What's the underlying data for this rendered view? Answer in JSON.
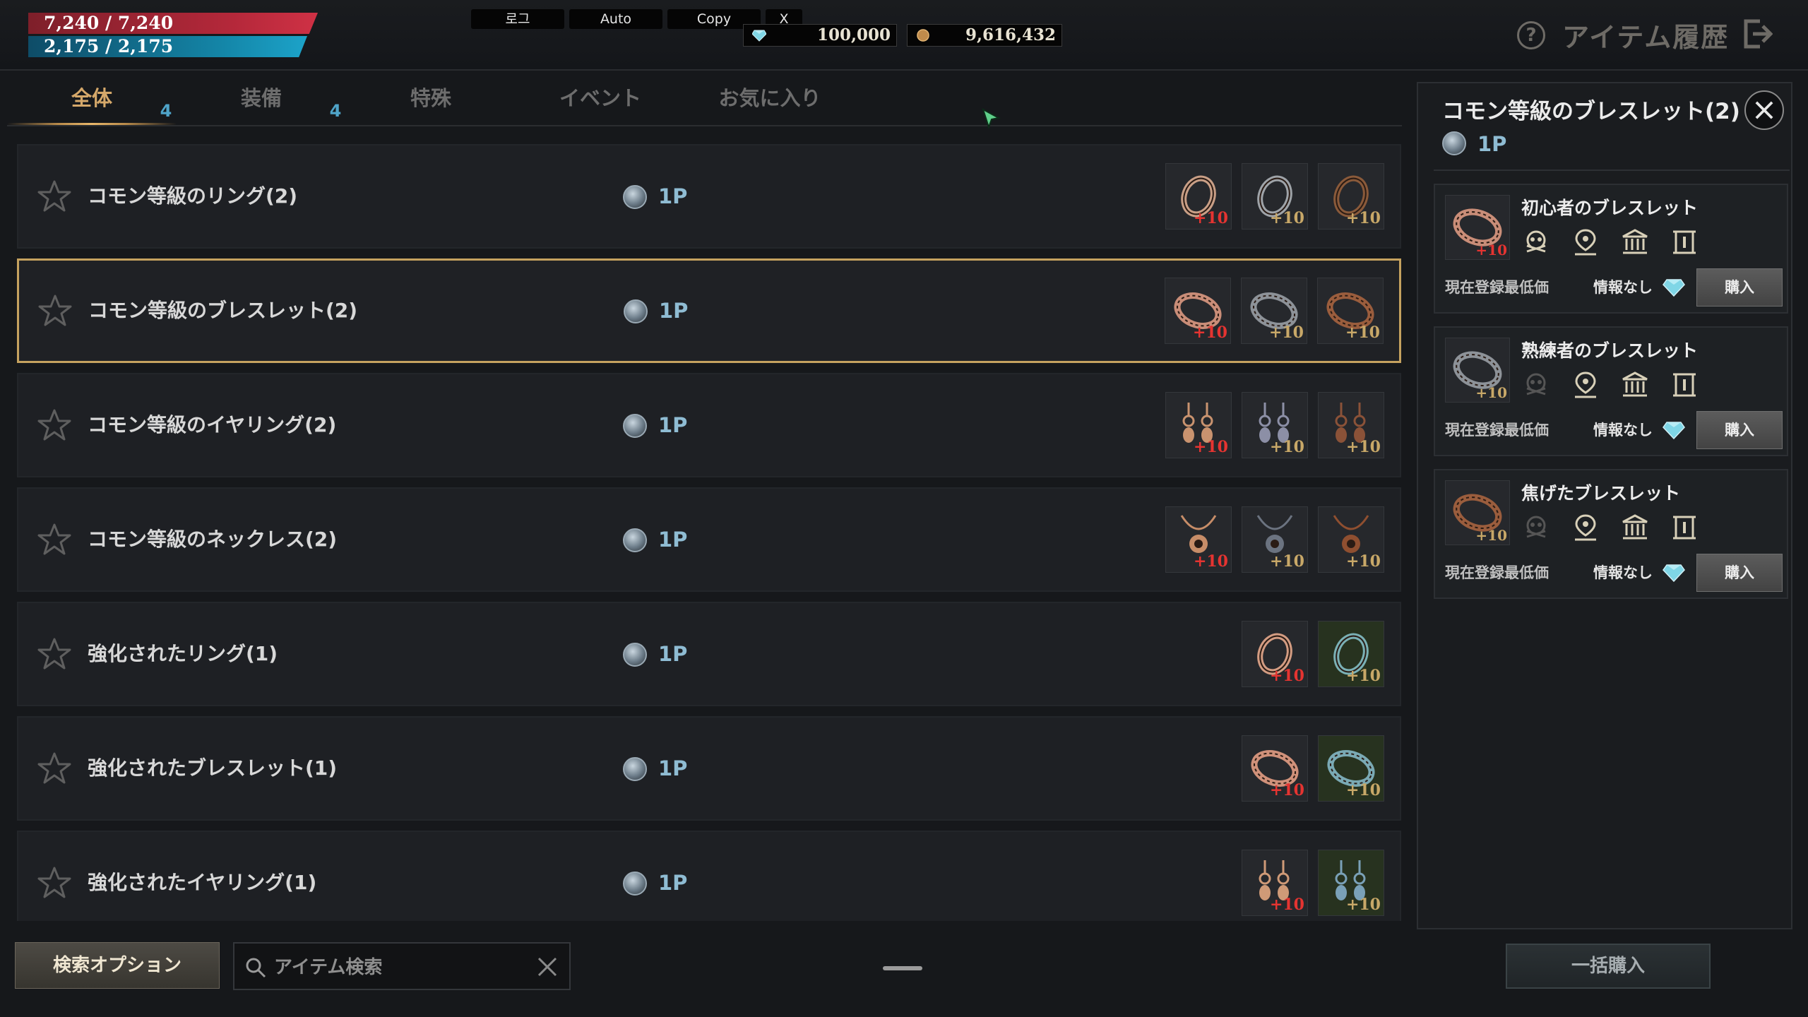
{
  "hud": {
    "hp": "7,240 / 7,240",
    "mp": "2,175 / 2,175"
  },
  "system_buttons": [
    "로그",
    "Auto",
    "Copy",
    "X"
  ],
  "currency": {
    "gems": "100,000",
    "gold": "9,616,432"
  },
  "header": {
    "title": "アイテム履歴"
  },
  "tabs": [
    {
      "label": "全体",
      "count": "4"
    },
    {
      "label": "装備",
      "count": "4"
    },
    {
      "label": "特殊",
      "count": ""
    },
    {
      "label": "イベント",
      "count": ""
    },
    {
      "label": "お気に入り",
      "count": ""
    }
  ],
  "rows": [
    {
      "name": "コモン等級のリング(2)",
      "point": "1P",
      "items": [
        {
          "kind": "ring",
          "color": "#c99f86",
          "plus": "+10",
          "plus_color": "red",
          "bg": "dark"
        },
        {
          "kind": "ring",
          "color": "#9ea3a8",
          "plus": "+10",
          "plus_color": "gold",
          "bg": "dark"
        },
        {
          "kind": "ring",
          "color": "#8a5a3a",
          "plus": "+10",
          "plus_color": "gold",
          "bg": "dark"
        }
      ]
    },
    {
      "name": "コモン等級のブレスレット(2)",
      "point": "1P",
      "items": [
        {
          "kind": "bracelet",
          "color": "#c98d78",
          "plus": "+10",
          "plus_color": "red",
          "bg": "dark"
        },
        {
          "kind": "bracelet",
          "color": "#8d9298",
          "plus": "+10",
          "plus_color": "gold",
          "bg": "dark"
        },
        {
          "kind": "bracelet",
          "color": "#9a5d3d",
          "plus": "+10",
          "plus_color": "gold",
          "bg": "dark"
        }
      ]
    },
    {
      "name": "コモン等級のイヤリング(2)",
      "point": "1P",
      "items": [
        {
          "kind": "earring",
          "color": "#c9936f",
          "plus": "+10",
          "plus_color": "red",
          "bg": "dark"
        },
        {
          "kind": "earring",
          "color": "#8c8fa6",
          "plus": "+10",
          "plus_color": "gold",
          "bg": "dark"
        },
        {
          "kind": "earring",
          "color": "#8b5238",
          "plus": "+10",
          "plus_color": "gold",
          "bg": "dark"
        }
      ]
    },
    {
      "name": "コモン等級のネックレス(2)",
      "point": "1P",
      "items": [
        {
          "kind": "necklace",
          "color": "#c78d68",
          "plus": "+10",
          "plus_color": "red",
          "bg": "dark"
        },
        {
          "kind": "necklace",
          "color": "#6b7380",
          "plus": "+10",
          "plus_color": "gold",
          "bg": "dark"
        },
        {
          "kind": "necklace",
          "color": "#8f4f30",
          "plus": "+10",
          "plus_color": "gold",
          "bg": "dark"
        }
      ]
    },
    {
      "name": "強化されたリング(1)",
      "point": "1P",
      "items": [
        {
          "kind": "ring",
          "color": "#d39c82",
          "plus": "+10",
          "plus_color": "red",
          "bg": "dark"
        },
        {
          "kind": "ring",
          "color": "#7ab0b5",
          "plus": "+10",
          "plus_color": "gold",
          "bg": "green"
        }
      ]
    },
    {
      "name": "強化されたブレスレット(1)",
      "point": "1P",
      "items": [
        {
          "kind": "bracelet",
          "color": "#d0917a",
          "plus": "+10",
          "plus_color": "red",
          "bg": "dark"
        },
        {
          "kind": "bracelet",
          "color": "#7aa9b4",
          "plus": "+10",
          "plus_color": "gold",
          "bg": "green"
        }
      ]
    },
    {
      "name": "強化されたイヤリング(1)",
      "point": "1P",
      "items": [
        {
          "kind": "earring",
          "color": "#cf9a77",
          "plus": "+10",
          "plus_color": "red",
          "bg": "dark"
        },
        {
          "kind": "earring",
          "color": "#7aa1b8",
          "plus": "+10",
          "plus_color": "gold",
          "bg": "green"
        }
      ]
    }
  ],
  "selected_row": 1,
  "bottom": {
    "search_options": "検索オプション",
    "search_placeholder": "アイテム検索",
    "bulk_buy": "一括購入"
  },
  "panel": {
    "title": "コモン等級のブレスレット(2)",
    "point": "1P",
    "cards": [
      {
        "name": "初心者のブレスレット",
        "color": "#c98d78",
        "plus": "+10",
        "plus_color": "red",
        "label": "現在登録最低価",
        "info": "情報なし",
        "buy": "購入",
        "skull_active": true
      },
      {
        "name": "熟練者のブレスレット",
        "color": "#8d9298",
        "plus": "+10",
        "plus_color": "gold",
        "label": "現在登録最低価",
        "info": "情報なし",
        "buy": "購入",
        "skull_active": false
      },
      {
        "name": "焦げたブレスレット",
        "color": "#9a5d3d",
        "plus": "+10",
        "plus_color": "gold",
        "label": "現在登録最低価",
        "info": "情報なし",
        "buy": "購入",
        "skull_active": false
      }
    ]
  },
  "colors": {
    "accent_gold": "#c5a25f",
    "tab_active": "#d5a86a",
    "point_blue": "#8fbcd3",
    "count_blue": "#4fa4c9",
    "plus_red": "#e53431",
    "plus_gold": "#c8a868"
  },
  "icons": {
    "star": "star-icon",
    "coin": "point-coin-icon",
    "gem": "diamond-icon",
    "gold_coin": "gold-coin-icon",
    "help": "help-icon",
    "exit": "exit-icon",
    "close": "close-icon",
    "search": "search-icon",
    "card_icons": [
      "skull-icon",
      "map-pin-icon",
      "bank-icon",
      "scroll-icon"
    ]
  }
}
